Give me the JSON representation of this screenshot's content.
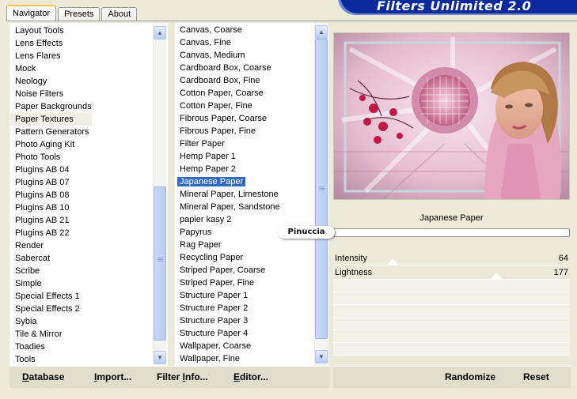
{
  "app": {
    "title": "Filters Unlimited 2.0"
  },
  "tabs": [
    {
      "label": "Navigator"
    },
    {
      "label": "Presets"
    },
    {
      "label": "About"
    }
  ],
  "categories": {
    "items": [
      "Layout Tools",
      "Lens Effects",
      "Lens Flares",
      "Mock",
      "Neology",
      "Noise Filters",
      "Paper Backgrounds",
      "Paper Textures",
      "Pattern Generators",
      "Photo Aging Kit",
      "Photo Tools",
      "Plugins AB 04",
      "Plugins AB 07",
      "Plugins AB 08",
      "Plugins AB 10",
      "Plugins AB 21",
      "Plugins AB 22",
      "Render",
      "Sabercat",
      "Scribe",
      "Simple",
      "Special Effects 1",
      "Special Effects 2",
      "Sybia",
      "Tile & Mirror",
      "Toadies",
      "Tools"
    ],
    "selected": "Paper Textures"
  },
  "filters": {
    "items": [
      "Canvas, Coarse",
      "Canvas, Fine",
      "Canvas, Medium",
      "Cardboard Box, Coarse",
      "Cardboard Box, Fine",
      "Cotton Paper, Coarse",
      "Cotton Paper, Fine",
      "Fibrous Paper, Coarse",
      "Fibrous Paper, Fine",
      "Filter Paper",
      "Hemp Paper 1",
      "Hemp Paper 2",
      "Japanese Paper",
      "Mineral Paper, Limestone",
      "Mineral Paper, Sandstone",
      "papier kasy 2",
      "Papyrus",
      "Rag Paper",
      "Recycling Paper",
      "Striped Paper, Coarse",
      "Striped Paper, Fine",
      "Structure Paper 1",
      "Structure Paper 2",
      "Structure Paper 3",
      "Structure Paper 4",
      "Wallpaper, Coarse",
      "Wallpaper, Fine"
    ],
    "selected": "Japanese Paper"
  },
  "preview": {
    "filter_name": "Japanese Paper",
    "badge": "Pinuccia"
  },
  "sliders": [
    {
      "label": "Intensity",
      "value": "64",
      "level": 0.25
    },
    {
      "label": "Lightness",
      "value": "177",
      "level": 0.69
    }
  ],
  "buttons": {
    "database": {
      "mnemonic": "D",
      "rest": "atabase"
    },
    "import": {
      "mnemonic": "I",
      "rest": "mport..."
    },
    "filter_info": {
      "pre": "Filter ",
      "mnemonic": "I",
      "rest": "nfo..."
    },
    "editor": {
      "mnemonic": "E",
      "rest": "ditor..."
    },
    "randomize": "Randomize",
    "reset": "Reset"
  },
  "colors": {
    "window_bg": "#ECE9D8",
    "selection": "#316AC5",
    "title_banner": "#0A2A9E"
  }
}
